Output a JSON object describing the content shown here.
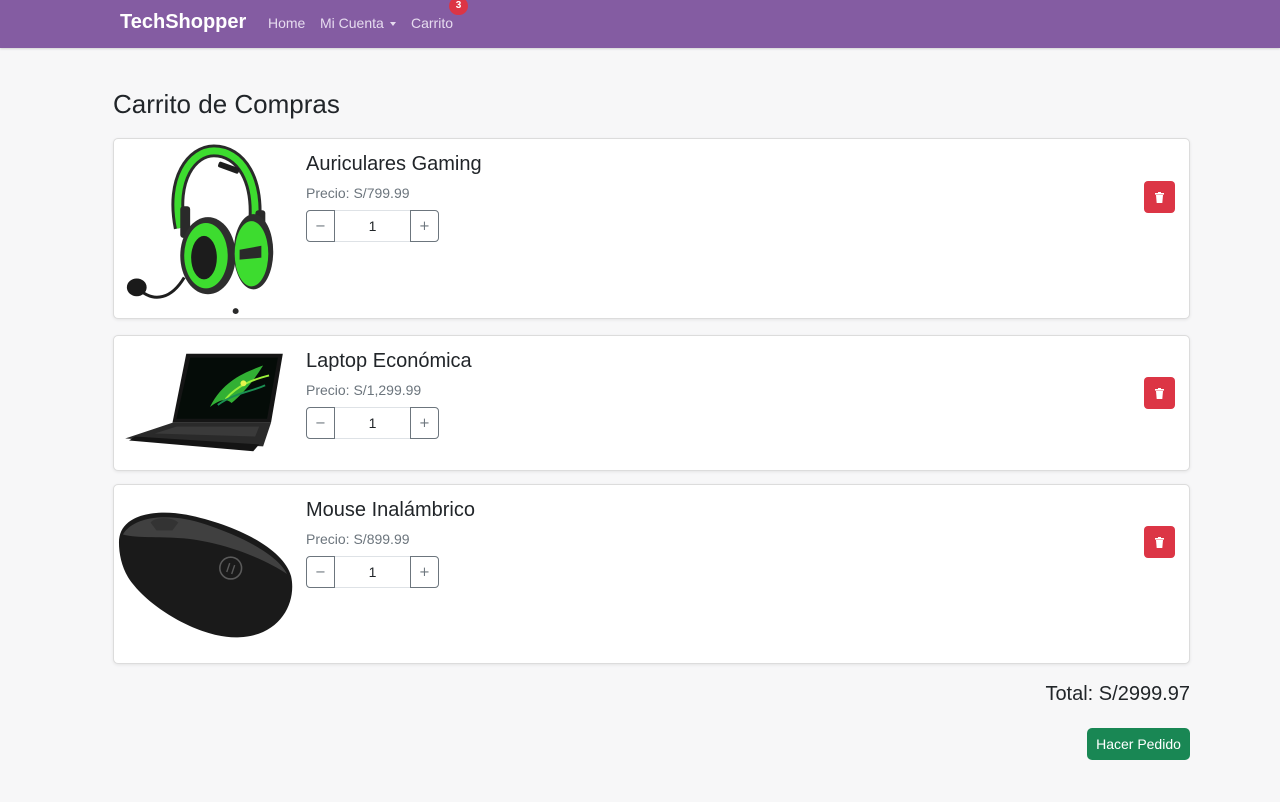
{
  "navbar": {
    "brand": "TechShopper",
    "home_label": "Home",
    "account_label": "Mi Cuenta",
    "cart_label": "Carrito",
    "cart_count": "3"
  },
  "page": {
    "title": "Carrito de Compras"
  },
  "cart": {
    "items": [
      {
        "name": "Auriculares Gaming",
        "price": "Precio: S/799.99",
        "quantity": "1",
        "image": "green-gaming-headset"
      },
      {
        "name": "Laptop Económica",
        "price": "Precio: S/1,299.99",
        "quantity": "1",
        "image": "black-laptop"
      },
      {
        "name": "Mouse Inalámbrico",
        "price": "Precio: S/899.99",
        "quantity": "1",
        "image": "black-wireless-mouse"
      }
    ],
    "decrement_symbol": "−",
    "increment_symbol": "+",
    "delete_icon": "trash-icon",
    "total": "Total: S/2999.97",
    "order_button": "Hacer Pedido"
  },
  "colors": {
    "navbar": "#845ca2",
    "danger": "#dc3545",
    "success": "#198754",
    "background": "#f7f7f8"
  }
}
